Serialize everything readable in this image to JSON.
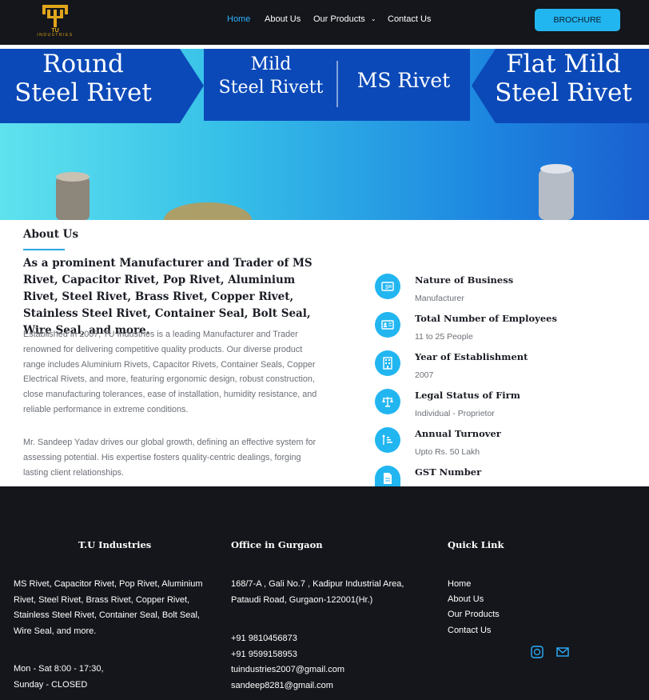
{
  "header": {
    "logo_text": "INDUSTRIES",
    "logo_mark": "TU",
    "nav": {
      "home": "Home",
      "about": "About Us",
      "products": "Our Products",
      "contact": "Contact Us"
    },
    "brochure_label": "BROCHURE"
  },
  "hero": {
    "left_line1": "Round",
    "left_line2": "Steel Rivet",
    "center_left_line1": "Mild",
    "center_left_line2": "Steel Rivett",
    "center_right": "MS Rivet",
    "right_line1": "Flat Mild",
    "right_line2": "Steel Rivet"
  },
  "about": {
    "title": "About Us",
    "heading": "As a prominent Manufacturer and Trader of MS Rivet, Capacitor Rivet, Pop Rivet, Aluminium Rivet, Steel Rivet, Brass Rivet, Copper Rivet, Stainless Steel Rivet, Container Seal, Bolt Seal, Wire Seal, and more.",
    "para1": "Established in 2007, TU Industries is a leading Manufacturer and Trader renowned for delivering competitive quality products. Our diverse product range includes Aluminium Rivets, Capacitor Rivets, Container Seals, Copper Electrical Rivets, and more, featuring ergonomic design, robust construction, close manufacturing tolerances, ease of installation, humidity resistance, and reliable performance in extreme conditions.",
    "para2": "Mr. Sandeep Yadav drives our global growth, defining an effective system for assessing potential. His expertise fosters quality-centric dealings, forging lasting client relationships."
  },
  "info": [
    {
      "label": "Nature of Business",
      "value": "Manufacturer",
      "icon": "money-icon"
    },
    {
      "label": "Total Number of Employees",
      "value": "11 to 25 People",
      "icon": "id-card-icon"
    },
    {
      "label": "Year of Establishment",
      "value": "2007",
      "icon": "building-icon"
    },
    {
      "label": "Legal Status of Firm",
      "value": "Individual - Proprietor",
      "icon": "scales-icon"
    },
    {
      "label": "Annual Turnover",
      "value": "Upto Rs. 50 Lakh",
      "icon": "sort-amount-icon"
    },
    {
      "label": "GST Number",
      "value": "",
      "icon": "document-icon"
    }
  ],
  "footer": {
    "col1": {
      "title": "T.U Industries",
      "desc_line1": "MS Rivet, Capacitor Rivet, Pop Rivet, Aluminium",
      "desc_line2": "Rivet, Steel Rivet, Brass Rivet, Copper Rivet,",
      "desc_line3": "Stainless Steel Rivet, Container Seal, Bolt Seal,",
      "desc_line4": "Wire Seal, and more.",
      "hours_line1": "Mon - Sat 8:00 - 17:30,",
      "hours_line2": "Sunday - CLOSED"
    },
    "col2": {
      "title": "Office in Gurgaon",
      "address_line1": "168/7-A , Gali No.7 , Kadipur Industrial Area,",
      "address_line2": "Pataudi Road, Gurgaon-122001(Hr.)",
      "phone1": "+91 9810456873",
      "phone2": "+91 9599158953",
      "email1": "tuindustries2007@gmail.com",
      "email2": "sandeep8281@gmail.com"
    },
    "col3": {
      "title": "Quick Link",
      "links": [
        "Home",
        "About Us",
        "Our Products",
        "Contact Us"
      ]
    }
  },
  "colors": {
    "accent": "#22b6f1",
    "dark": "#14161b",
    "hero_blue": "#0b49b8",
    "logo_gold": "#e0a51b"
  }
}
